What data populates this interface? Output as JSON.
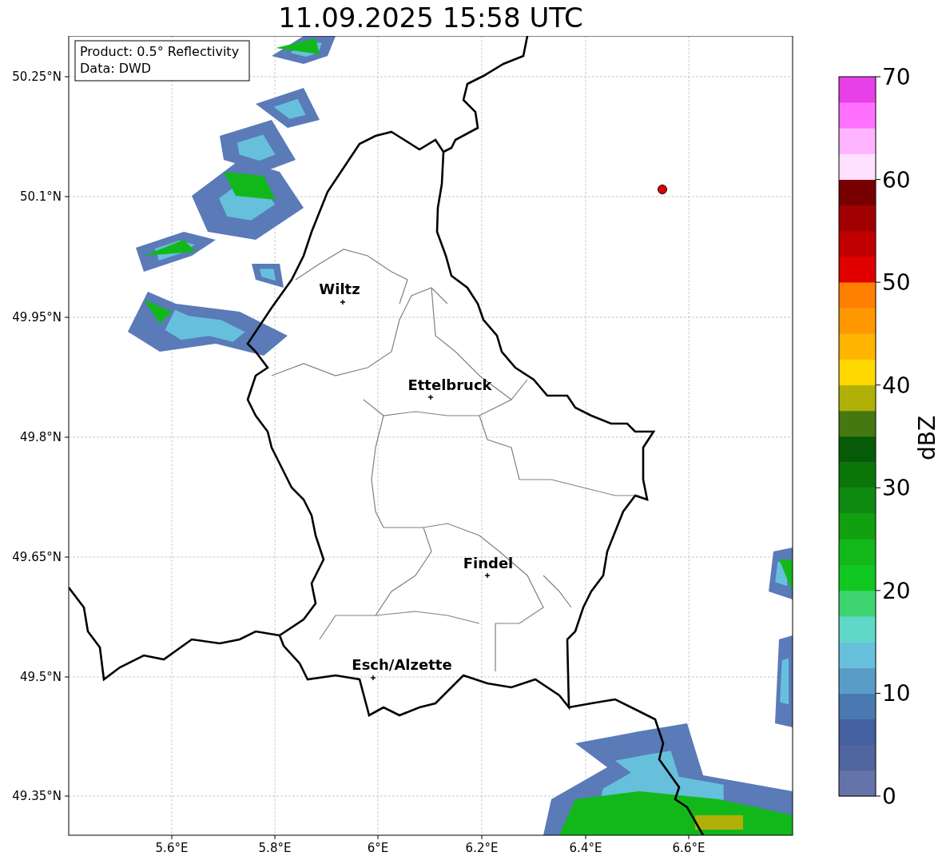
{
  "title": "11.09.2025 15:58 UTC",
  "map": {
    "info_box": [
      "Product: 0.5° Reflectivity",
      "Data: DWD"
    ],
    "y_ticks": [
      "50.25°N",
      "50.1°N",
      "49.95°N",
      "49.8°N",
      "49.65°N",
      "49.5°N",
      "49.35°N"
    ],
    "x_ticks": [
      "5.6°E",
      "5.8°E",
      "6°E",
      "6.2°E",
      "6.4°E",
      "6.6°E"
    ],
    "cities": [
      {
        "name": "Wiltz"
      },
      {
        "name": "Ettelbruck"
      },
      {
        "name": "Findel"
      },
      {
        "name": "Esch/Alzette"
      }
    ]
  },
  "colorbar": {
    "label": "dBZ",
    "ticks": [
      "70",
      "60",
      "50",
      "40",
      "30",
      "20",
      "10",
      "0"
    ],
    "segments": [
      {
        "color": "#6673a8"
      },
      {
        "color": "#5165a0"
      },
      {
        "color": "#4460a0"
      },
      {
        "color": "#4a78b0"
      },
      {
        "color": "#5a9cc8"
      },
      {
        "color": "#66c0dc"
      },
      {
        "color": "#60d8c8"
      },
      {
        "color": "#3ed470"
      },
      {
        "color": "#10c820"
      },
      {
        "color": "#12b81a"
      },
      {
        "color": "#10a010"
      },
      {
        "color": "#0e8a10"
      },
      {
        "color": "#0a760a"
      },
      {
        "color": "#075a08"
      },
      {
        "color": "#457810"
      },
      {
        "color": "#b0b008"
      },
      {
        "color": "#ffd700"
      },
      {
        "color": "#ffb400"
      },
      {
        "color": "#ff9800"
      },
      {
        "color": "#ff7f00"
      },
      {
        "color": "#e00000"
      },
      {
        "color": "#c00000"
      },
      {
        "color": "#a00000"
      },
      {
        "color": "#780000"
      },
      {
        "color": "#ffe0ff"
      },
      {
        "color": "#ffb4ff"
      },
      {
        "color": "#ff70ff"
      },
      {
        "color": "#e840e8"
      }
    ]
  }
}
